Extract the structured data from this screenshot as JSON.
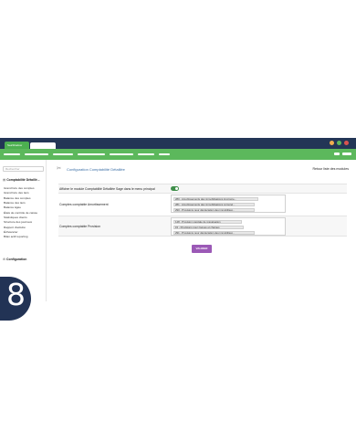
{
  "app": {
    "active_tab": "SeaShadow",
    "menu_items": [
      "",
      "",
      "",
      "",
      "",
      "",
      ""
    ]
  },
  "window_dots": [
    "#f0ad4e",
    "#5cb85c",
    "#d9534f"
  ],
  "sidebar": {
    "search_placeholder": "Rechercher",
    "section1_title": "Comptabilité Détaillé...",
    "items": [
      "Grand livre des comptes",
      "Grand livre des tiers",
      "Balance des comptes",
      "Balance des tiers",
      "Balance âgée",
      "États de contrôle de caisse",
      "Statistiques clients",
      "Structure des journaux",
      "Rapport d'activité",
      "Échéancier",
      "Bilan actif reporting"
    ],
    "section2_title": "Configuration"
  },
  "main": {
    "page_title": "Configuration Comptabilité Détaillée",
    "back_link": "Retour liste des modules",
    "toggle_label": "Afficher le module Comptabilité Détaillée Sage dans le menu principal",
    "toggle_on": true,
    "amort_label": "Comptes comptable Amortissement",
    "amort_accounts": [
      "280 - Amortissements des immobilisations incorpore...",
      "281 - Amortissements des immobilisations corporel...",
      "290 - Provisions pour dépréciation des immobilisat..."
    ],
    "prov_label": "Comptes comptable Provision",
    "prov_accounts": [
      "148 - Provision spéciale de réévaluation",
      "15 - Provisions pour risques et charges",
      "291 - Provisions pour dépréciation des immobilisat..."
    ],
    "save_label": "VALIDER"
  },
  "badge_number": "8"
}
